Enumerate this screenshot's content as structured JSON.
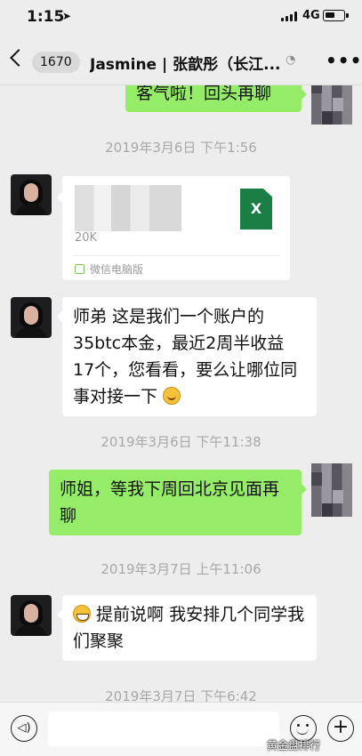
{
  "status_bar": {
    "time": "1:15",
    "network": "4G"
  },
  "nav": {
    "unread_count": "1670",
    "title": "Jasmine | 张歆彤（长江..."
  },
  "messages": {
    "m1": {
      "text": "客气啦！回头再聊"
    },
    "ts1": "2019年3月6日 下午1:56",
    "file": {
      "size": "20K",
      "icon_label": "X",
      "source": "微信电脑版"
    },
    "m2": {
      "text": "师弟 这是我们一个账户的35btc本金，最近2周半收益 17个，您看看，要么让哪位同事对接一下"
    },
    "ts2": "2019年3月6日 下午11:38",
    "m3": {
      "text": "师姐，等我下周回北京见面再聊"
    },
    "ts3": "2019年3月7日 上午11:06",
    "m4": {
      "text": "提前说啊 我安排几个同学我们聚聚"
    },
    "ts4": "2019年3月7日 下午6:42"
  },
  "watermark": "黄金盘排行"
}
